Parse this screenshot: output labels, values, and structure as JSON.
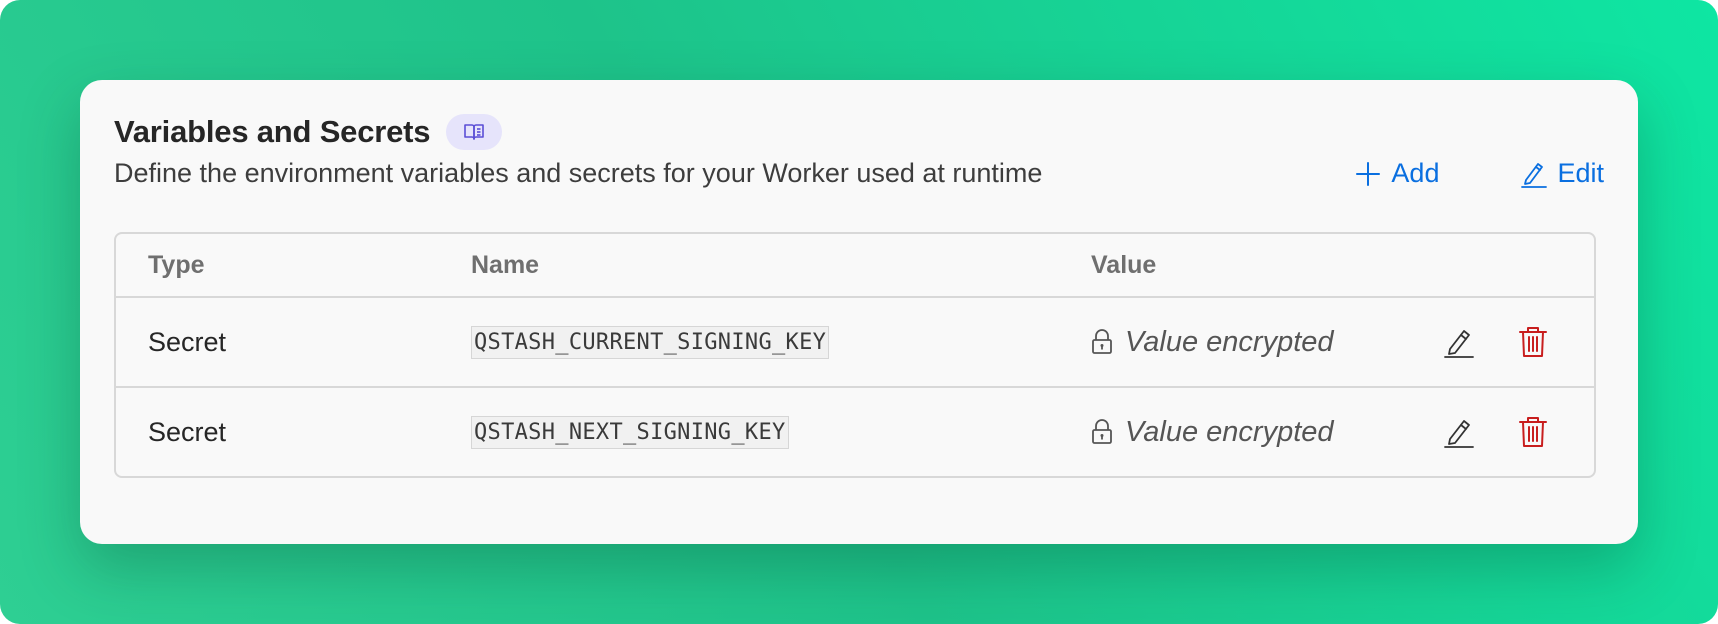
{
  "section": {
    "title": "Variables and Secrets",
    "description": "Define the environment variables and secrets for your Worker used at runtime"
  },
  "actions": {
    "add_label": "Add",
    "edit_label": "Edit"
  },
  "table": {
    "columns": [
      "Type",
      "Name",
      "Value"
    ],
    "rows": [
      {
        "type": "Secret",
        "name": "QSTASH_CURRENT_SIGNING_KEY",
        "value": "Value encrypted"
      },
      {
        "type": "Secret",
        "name": "QSTASH_NEXT_SIGNING_KEY",
        "value": "Value encrypted"
      }
    ]
  },
  "icons": {
    "docs": "book-icon",
    "add": "plus-icon",
    "edit": "pencil-icon",
    "lock": "lock-icon",
    "delete": "trash-icon"
  },
  "colors": {
    "background_start": "#2ecf93",
    "background_end": "#0ee6a3",
    "card": "#f9f9f9",
    "accent": "#0a6fe0",
    "danger": "#c81e1e",
    "badge": "#e6e4fb",
    "badge_icon": "#5b4fd6"
  }
}
